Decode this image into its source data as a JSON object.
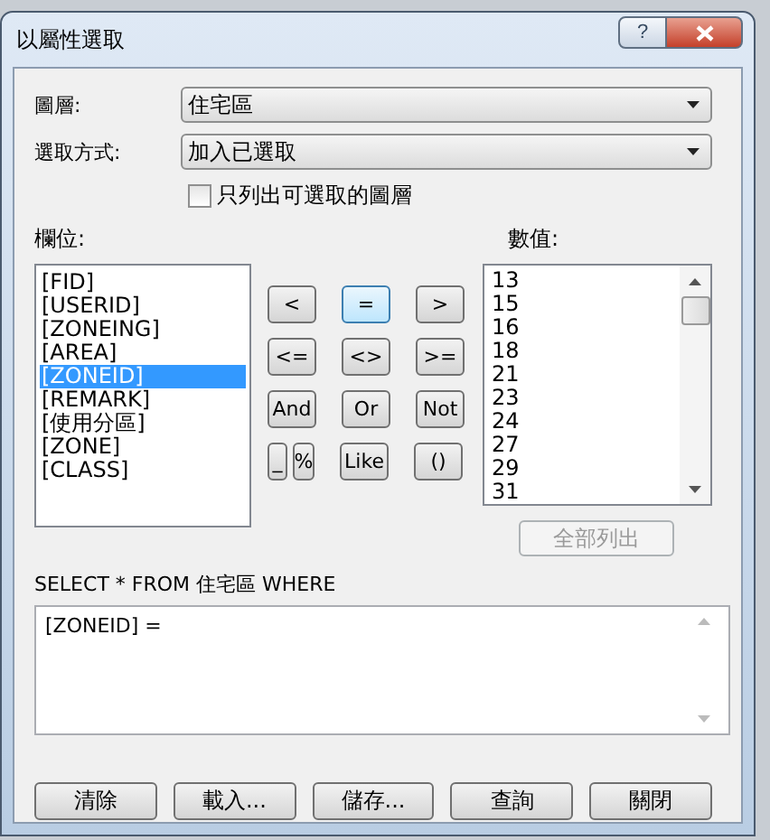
{
  "window": {
    "title": "以屬性選取",
    "help_button": "?"
  },
  "layer": {
    "label": "圖層:",
    "value": "住宅區"
  },
  "method": {
    "label": "選取方式:",
    "value": "加入已選取"
  },
  "only_selectable": {
    "label": "只列出可選取的圖層",
    "checked": false
  },
  "fields": {
    "label": "欄位:",
    "items": [
      {
        "name": "[FID]",
        "selected": false
      },
      {
        "name": "[USERID]",
        "selected": false
      },
      {
        "name": "[ZONEING]",
        "selected": false
      },
      {
        "name": "[AREA]",
        "selected": false
      },
      {
        "name": "[ZONEID]",
        "selected": true
      },
      {
        "name": "[REMARK]",
        "selected": false
      },
      {
        "name": "[使用分區]",
        "selected": false
      },
      {
        "name": "[ZONE]",
        "selected": false
      },
      {
        "name": "[CLASS]",
        "selected": false
      }
    ]
  },
  "operator_rows": [
    [
      {
        "label": "<",
        "focused": false
      },
      {
        "label": "=",
        "focused": true
      },
      {
        "label": ">",
        "focused": false
      }
    ],
    [
      {
        "label": "<=",
        "focused": false
      },
      {
        "label": "<>",
        "focused": false
      },
      {
        "label": ">=",
        "focused": false
      }
    ],
    [
      {
        "label": "And",
        "focused": false
      },
      {
        "label": "Or",
        "focused": false
      },
      {
        "label": "Not",
        "focused": false
      }
    ],
    [
      {
        "label": "_",
        "focused": false
      },
      {
        "label": "%",
        "focused": false
      },
      {
        "label": "Like",
        "focused": false
      },
      {
        "label": "()",
        "focused": false
      }
    ]
  ],
  "values": {
    "label": "數值:",
    "items": [
      "13",
      "15",
      "16",
      "18",
      "21",
      "23",
      "24",
      "27",
      "29",
      "31"
    ],
    "list_all_button": {
      "label": "全部列出",
      "disabled": true
    }
  },
  "query": {
    "label": "SELECT * FROM 住宅區 WHERE",
    "expression": "[ZONEID] ="
  },
  "buttons": [
    "清除",
    "載入...",
    "儲存...",
    "查詢",
    "關閉"
  ]
}
